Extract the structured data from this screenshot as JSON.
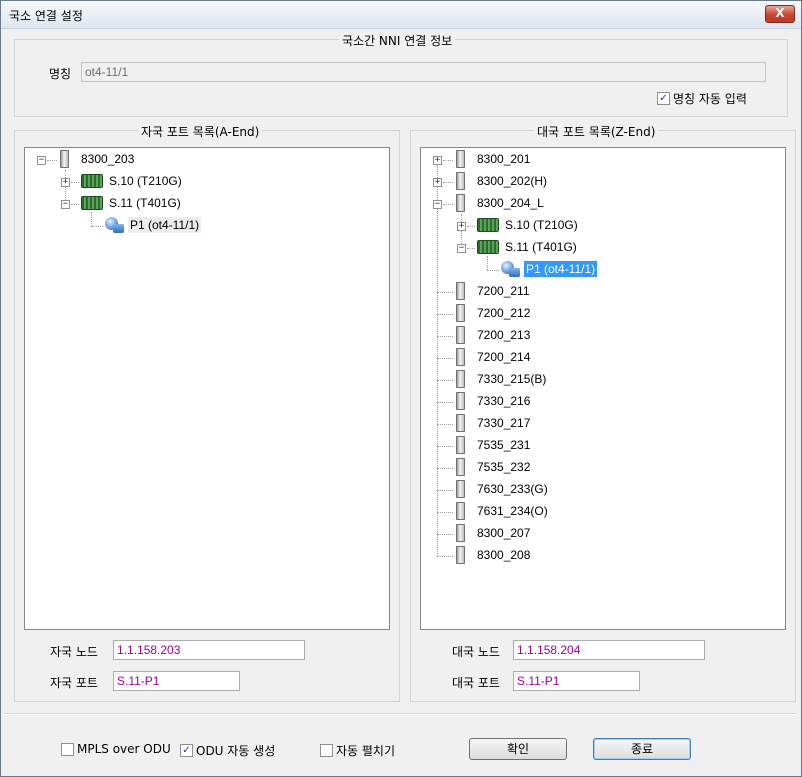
{
  "window": {
    "title": "국소 연결 설정",
    "close_label": "X"
  },
  "nni": {
    "group_title": "국소간 NNI 연결 정보",
    "name_label": "명칭",
    "name_value": "ot4-11/1",
    "auto_name_label": "명칭 자동 입력",
    "auto_name_checked": true
  },
  "a_end": {
    "group_title": "자국 포트 목록(A-End)",
    "tree": {
      "root": "8300_203",
      "card1": "S.10 (T210G)",
      "card2": "S.11 (T401G)",
      "port": "P1 (ot4-11/1)"
    },
    "node_label": "자국 노드",
    "node_value": "1.1.158.203",
    "port_label": "자국 포트",
    "port_value": "S.11-P1"
  },
  "z_end": {
    "group_title": "대국 포트 목록(Z-End)",
    "tree": {
      "n1": "8300_201",
      "n2": "8300_202(H)",
      "n3": "8300_204_L",
      "card1": "S.10 (T210G)",
      "card2": "S.11 (T401G)",
      "port": "P1 (ot4-11/1)",
      "others": [
        "7200_211",
        "7200_212",
        "7200_213",
        "7200_214",
        "7330_215(B)",
        "7330_216",
        "7330_217",
        "7535_231",
        "7535_232",
        "7630_233(G)",
        "7631_234(O)",
        "8300_207",
        "8300_208"
      ]
    },
    "node_label": "대국 노드",
    "node_value": "1.1.158.204",
    "port_label": "대국 포트",
    "port_value": "S.11-P1"
  },
  "footer": {
    "mpls_label": "MPLS over ODU",
    "mpls_checked": false,
    "odu_label": "ODU 자동 생성",
    "odu_checked": true,
    "expand_label": "자동 펼치기",
    "expand_checked": false,
    "ok_label": "확인",
    "close_label": "종료"
  },
  "icons": {
    "device": "device-rack-icon",
    "card": "board-card-icon",
    "port": "port-icon",
    "expand": "expand-icon",
    "collapse": "collapse-icon"
  },
  "colors": {
    "value_text": "#a000a0",
    "selection": "#3399ff"
  }
}
